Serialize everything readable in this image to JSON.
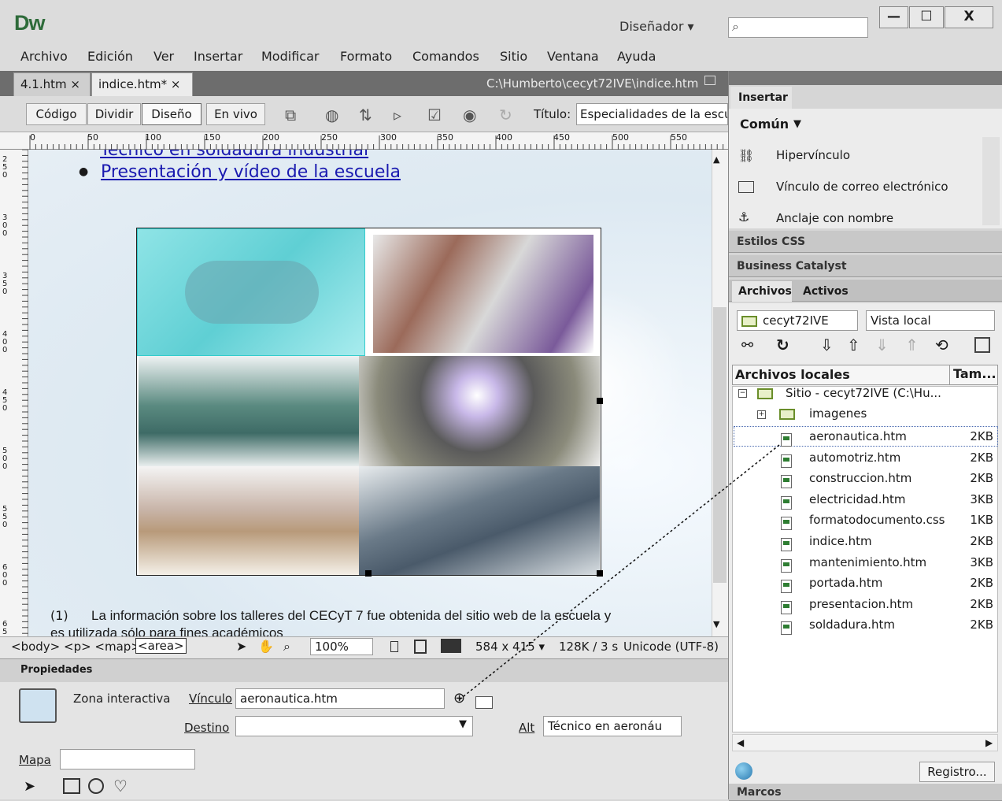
{
  "app": {
    "logo": "Dw",
    "workspace": "Diseñador ▾"
  },
  "search": {
    "icon": "⌕"
  },
  "window_buttons": [
    "—",
    "☐",
    "X"
  ],
  "menu": [
    "Archivo",
    "Edición",
    "Ver",
    "Insertar",
    "Modificar",
    "Formato",
    "Comandos",
    "Sitio",
    "Ventana",
    "Ayuda"
  ],
  "tabs": [
    {
      "label": "4.1.htm ×"
    },
    {
      "label": "indice.htm*  ×"
    }
  ],
  "doc_path": "C:\\Humberto\\cecyt72IVE\\indice.htm",
  "view_buttons": [
    "Código",
    "Dividir",
    "Diseño",
    "En vivo"
  ],
  "title": {
    "label": "Título:",
    "value": "Especialidades de la escuela"
  },
  "ruler_h": [
    "0",
    "50",
    "100",
    "150",
    "200",
    "250",
    "300",
    "350",
    "400",
    "450",
    "500",
    "550"
  ],
  "ruler_v": [
    "2 5 0",
    "3 0 0",
    "3 5 0",
    "4 0 0",
    "4 5 0",
    "5 0 0",
    "5 5 0",
    "6 0 0",
    "6 5"
  ],
  "page": {
    "links": [
      "Técnico en soldadura industrial",
      "Presentación y vídeo de la escuela"
    ],
    "footnote_mark": "(1)",
    "footnote": "La información sobre los talleres del CECyT 7 fue obtenida del sitio web de la escuela y",
    "footnote2": "es utilizada sólo para fines académicos"
  },
  "status": {
    "tags": "<body> <p> <map>",
    "area": "<area>",
    "zoom": "100%",
    "size": "584 x 415 ▾",
    "download": "128K / 3 s",
    "encoding": "Unicode (UTF-8)"
  },
  "properties": {
    "header": "Propiedades",
    "type": "Zona interactiva",
    "link_label": "Vínculo",
    "link_value": "aeronautica.htm",
    "target_label": "Destino",
    "alt_label": "Alt",
    "alt_value": "Técnico  en aeronáu",
    "map_label": "Mapa"
  },
  "panels": {
    "insert_tab": "Insertar",
    "category": "Común",
    "insert_items": [
      "Hipervínculo",
      "Vínculo de correo electrónico",
      "Anclaje con nombre"
    ],
    "css": "Estilos CSS",
    "bc": "Business Catalyst",
    "files_tab": "Archivos",
    "assets_tab": "Activos",
    "site_select": "cecyt72IVE",
    "view_select": "Vista local",
    "col_name": "Archivos locales",
    "col_size": "Tam...",
    "root": "Sitio - cecyt72IVE (C:\\Hu...",
    "folder": "imagenes",
    "files": [
      {
        "name": "aeronautica.htm",
        "size": "2KB"
      },
      {
        "name": "automotriz.htm",
        "size": "2KB"
      },
      {
        "name": "construccion.htm",
        "size": "2KB"
      },
      {
        "name": "electricidad.htm",
        "size": "3KB"
      },
      {
        "name": "formatodocumento.css",
        "size": "1KB"
      },
      {
        "name": "indice.htm",
        "size": "2KB"
      },
      {
        "name": "mantenimiento.htm",
        "size": "3KB"
      },
      {
        "name": "portada.htm",
        "size": "2KB"
      },
      {
        "name": "presentacion.htm",
        "size": "2KB"
      },
      {
        "name": "soldadura.htm",
        "size": "2KB"
      }
    ],
    "log_button": "Registro...",
    "frames": "Marcos"
  }
}
